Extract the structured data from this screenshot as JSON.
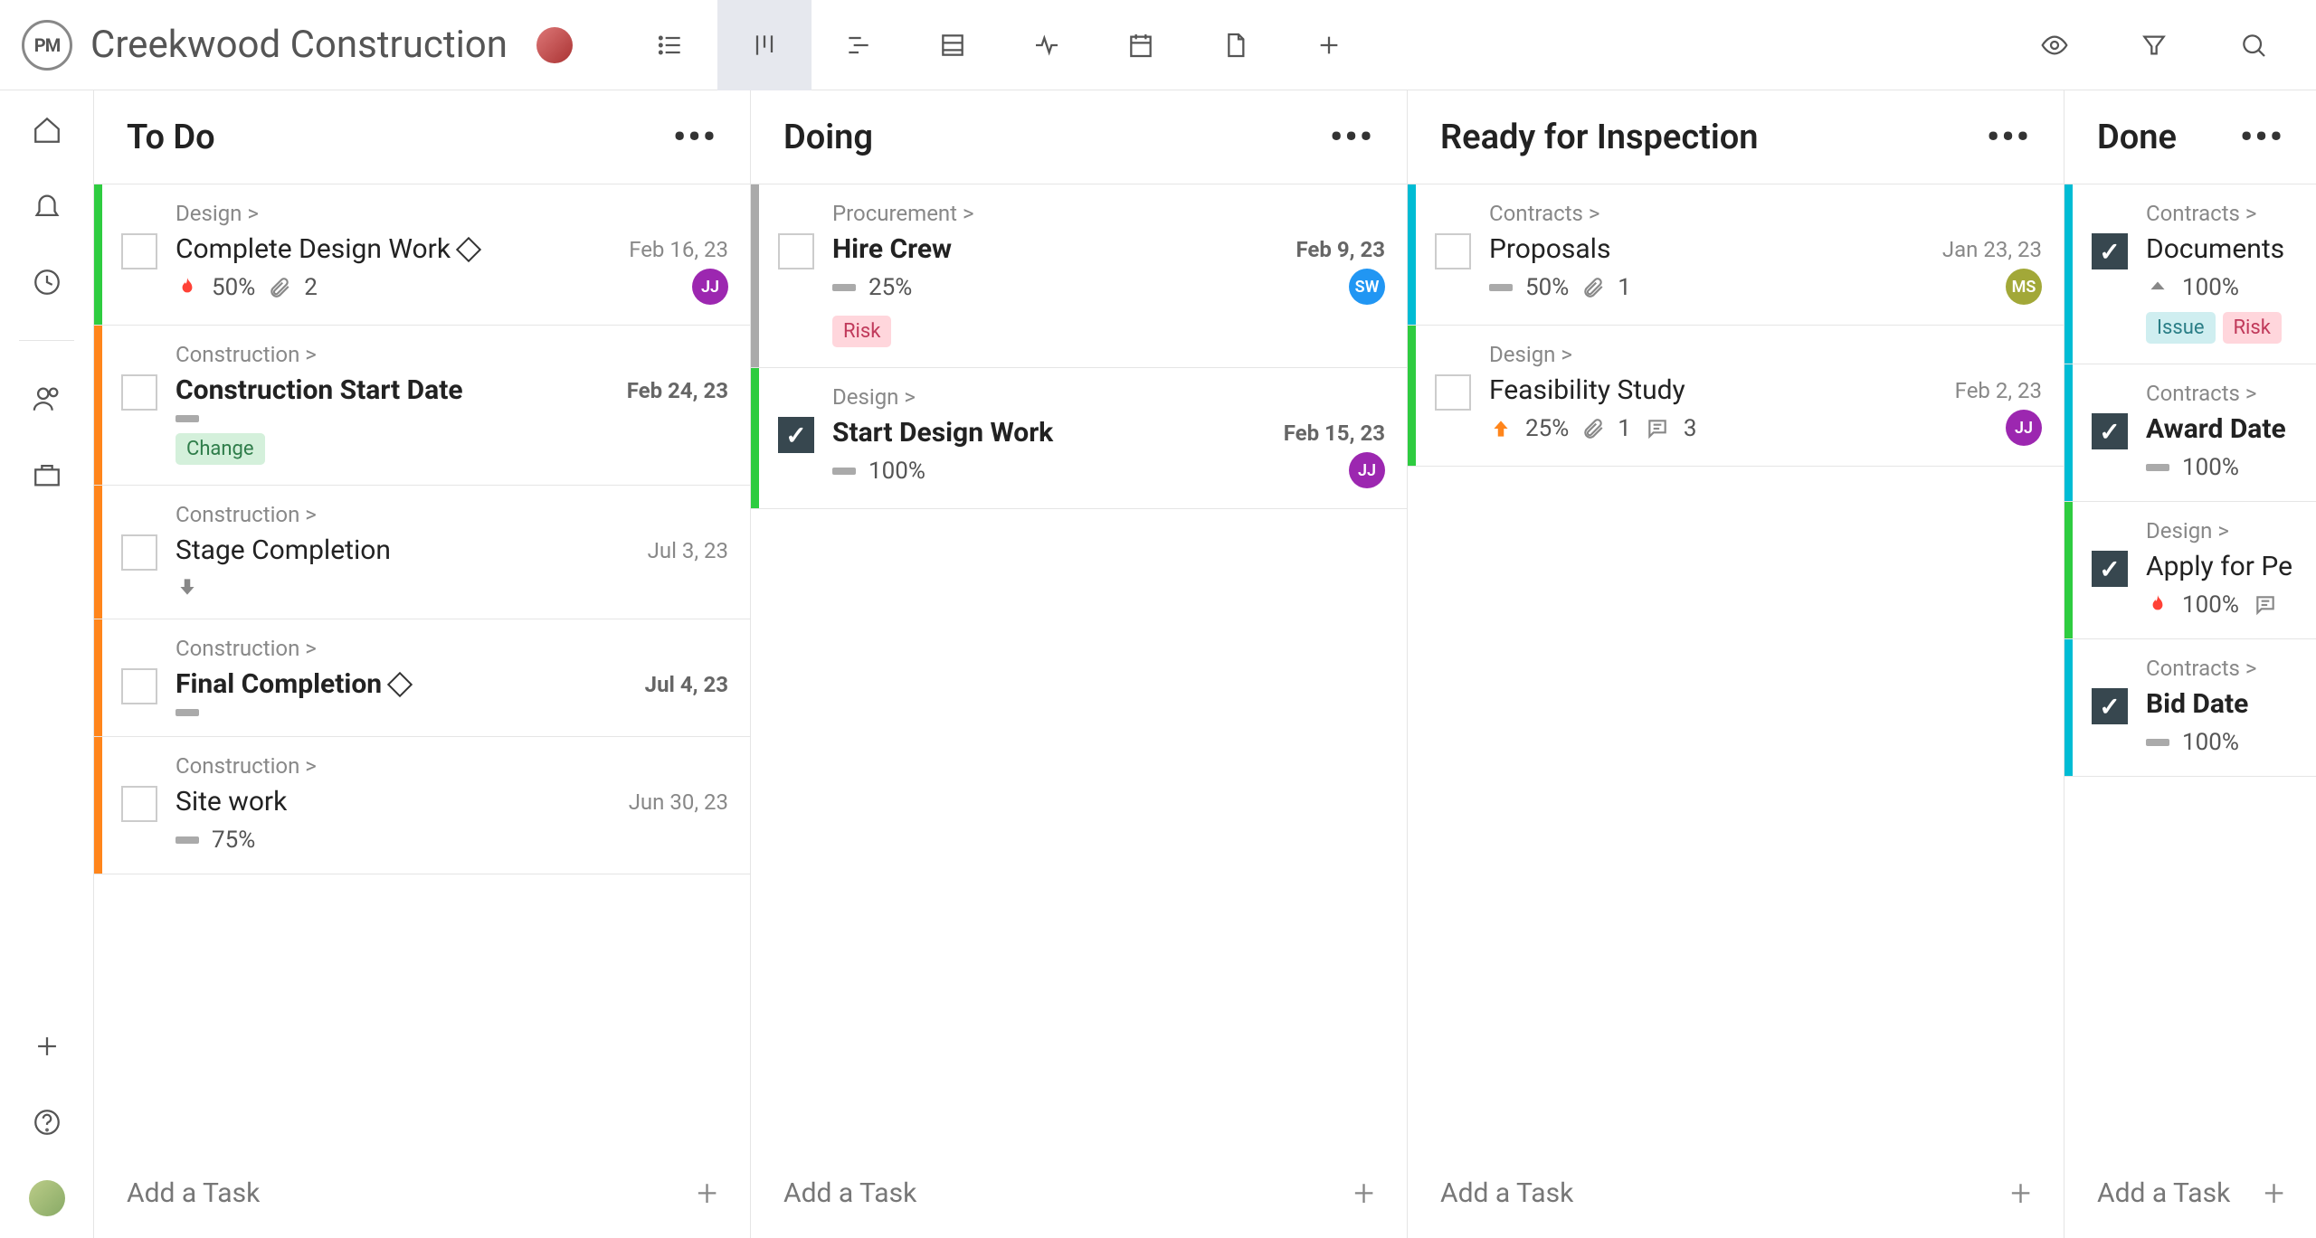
{
  "project_title": "Creekwood Construction",
  "add_task_label": "Add a Task",
  "columns": [
    {
      "title": "To Do",
      "cards": [
        {
          "stripe": "green",
          "checked": false,
          "breadcrumb": "Design >",
          "title": "Complete Design Work",
          "diamond": true,
          "bold": false,
          "date": "Feb 16, 23",
          "date_bold": false,
          "priority": "fire",
          "pct": "50%",
          "attachments": "2",
          "assignee": {
            "initials": "JJ",
            "color": "purple"
          }
        },
        {
          "stripe": "orange",
          "checked": false,
          "breadcrumb": "Construction >",
          "title": "Construction Start Date",
          "bold": true,
          "date": "Feb 24, 23",
          "date_bold": true,
          "bar": true,
          "tags": [
            "Change"
          ]
        },
        {
          "stripe": "orange",
          "checked": false,
          "breadcrumb": "Construction >",
          "title": "Stage Completion",
          "date": "Jul 3, 23",
          "priority": "down"
        },
        {
          "stripe": "orange",
          "checked": false,
          "breadcrumb": "Construction >",
          "title": "Final Completion",
          "diamond": true,
          "bold": true,
          "date": "Jul 4, 23",
          "date_bold": true,
          "bar": true
        },
        {
          "stripe": "orange",
          "checked": false,
          "breadcrumb": "Construction >",
          "title": "Site work",
          "date": "Jun 30, 23",
          "bar": true,
          "pct": "75%"
        }
      ]
    },
    {
      "title": "Doing",
      "cards": [
        {
          "stripe": "gray",
          "checked": false,
          "breadcrumb": "Procurement >",
          "title": "Hire Crew",
          "bold": true,
          "date": "Feb 9, 23",
          "date_bold": true,
          "bar": true,
          "pct": "25%",
          "assignee": {
            "initials": "SW",
            "color": "blue"
          },
          "tags": [
            "Risk"
          ]
        },
        {
          "stripe": "green",
          "checked": true,
          "breadcrumb": "Design >",
          "title": "Start Design Work",
          "bold": true,
          "date": "Feb 15, 23",
          "date_bold": true,
          "bar": true,
          "pct": "100%",
          "assignee": {
            "initials": "JJ",
            "color": "purple"
          }
        }
      ]
    },
    {
      "title": "Ready for Inspection",
      "cards": [
        {
          "stripe": "cyan",
          "checked": false,
          "breadcrumb": "Contracts >",
          "title": "Proposals",
          "date": "Jan 23, 23",
          "bar": true,
          "pct": "50%",
          "attachments": "1",
          "assignee": {
            "initials": "MS",
            "color": "olive"
          }
        },
        {
          "stripe": "green",
          "checked": false,
          "breadcrumb": "Design >",
          "title": "Feasibility Study",
          "date": "Feb 2, 23",
          "priority": "up",
          "pct": "25%",
          "attachments": "1",
          "comments": "3",
          "assignee": {
            "initials": "JJ",
            "color": "purple"
          }
        }
      ]
    },
    {
      "title": "Done",
      "narrow": true,
      "cards": [
        {
          "stripe": "cyan",
          "checked": true,
          "breadcrumb": "Contracts >",
          "title": "Documents",
          "priority": "upgray",
          "pct": "100%",
          "tags": [
            "Issue",
            "Risk"
          ]
        },
        {
          "stripe": "cyan",
          "checked": true,
          "breadcrumb": "Contracts >",
          "title": "Award Date",
          "bold": true,
          "bar": true,
          "pct": "100%"
        },
        {
          "stripe": "green",
          "checked": true,
          "breadcrumb": "Design >",
          "title": "Apply for Pe",
          "priority": "fire",
          "pct": "100%",
          "comments": ""
        },
        {
          "stripe": "cyan",
          "checked": true,
          "breadcrumb": "Contracts >",
          "title": "Bid Date",
          "bold": true,
          "bar": true,
          "pct": "100%"
        }
      ]
    }
  ]
}
